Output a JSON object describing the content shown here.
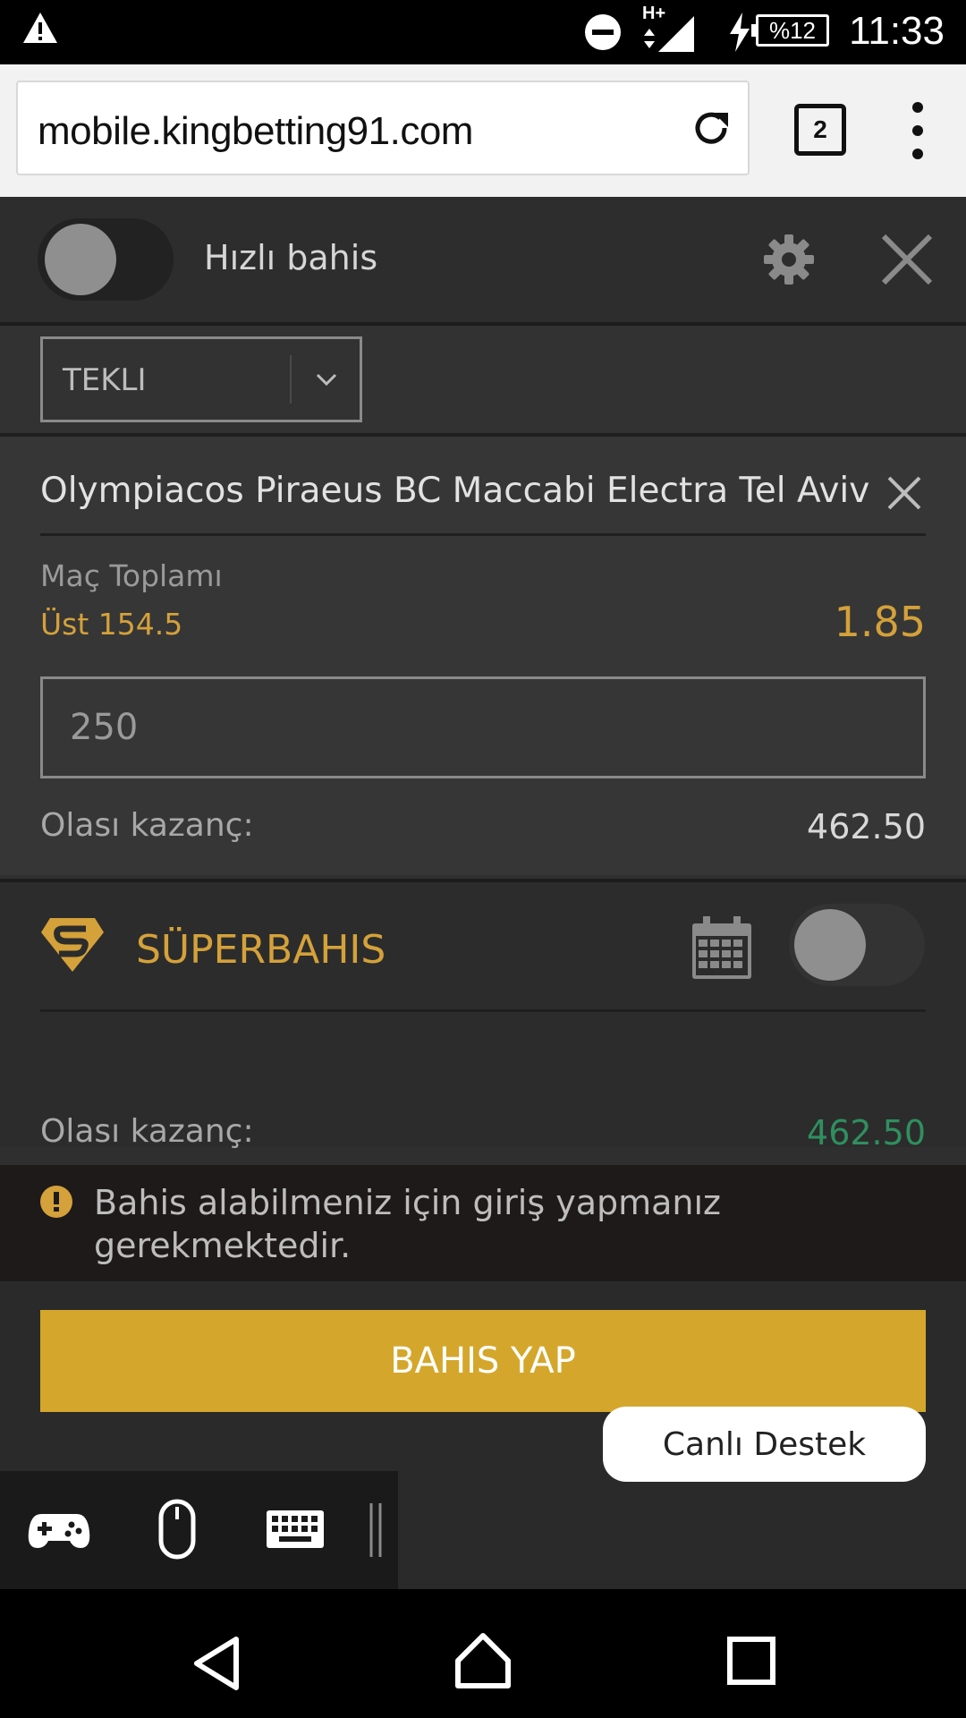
{
  "status_bar": {
    "time": "11:33",
    "battery": "%12",
    "network": "H+",
    "icons": [
      "warning-icon",
      "do-not-disturb-icon",
      "signal-icon",
      "charging-icon",
      "battery-icon"
    ]
  },
  "browser": {
    "url": "mobile.kingbetting91.com",
    "tab_count": "2",
    "icons": [
      "reload-icon",
      "tabs-icon",
      "overflow-menu-icon"
    ]
  },
  "quick_bet": {
    "label": "Hızlı bahis",
    "enabled": false,
    "icons": [
      "settings-gear-icon",
      "close-icon"
    ]
  },
  "bet_type": {
    "selected": "TEKLI"
  },
  "bet": {
    "match": "Olympiacos Piraeus BC Maccabi Electra Tel Aviv",
    "market": "Maç Toplamı",
    "selection": "Üst 154.5",
    "odds": "1.85",
    "stake": "250",
    "payout_label": "Olası kazanç:",
    "payout_value": "462.50"
  },
  "superbahis": {
    "label": "SÜPERBAHIS",
    "enabled": false,
    "payout_label": "Olası kazanç:",
    "payout_value": "462.50"
  },
  "notice": {
    "text": "Bahis alabilmeniz için giriş yapmanız gerekmektedir."
  },
  "actions": {
    "place_bet": "BAHIS YAP",
    "live_support": "Canlı Destek"
  },
  "colors": {
    "accent": "#d4a13a",
    "button": "#d4a72c",
    "positive": "#2f8f5f",
    "panel": "#363636"
  }
}
